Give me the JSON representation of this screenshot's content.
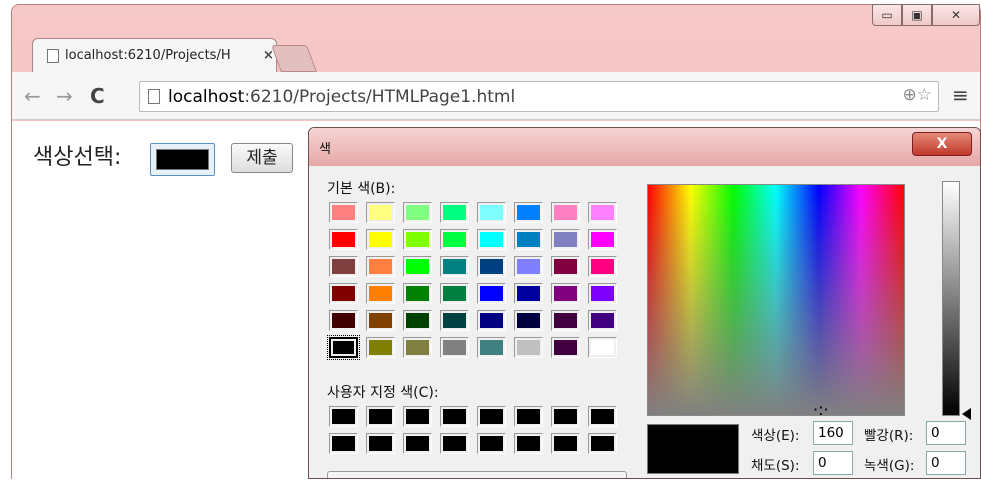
{
  "browser": {
    "tab_title": "localhost:6210/Projects/H",
    "tab_close": "×",
    "url_host": "localhost",
    "url_rest": ":6210/Projects/HTMLPage1.html",
    "back_icon": "arrow-left-icon",
    "forward_icon": "arrow-right-icon",
    "reload_icon": "reload-icon",
    "minimize": "▭",
    "maximize": "▣",
    "close": "✕"
  },
  "page": {
    "label": "색상선택:",
    "submit_label": "제출",
    "color_value": "#000000"
  },
  "dialog": {
    "title": "색",
    "close_label": "X",
    "basic_colors_label": "기본 색(B):",
    "custom_colors_label": "사용자 지정 색(C):",
    "basic_colors": [
      "#ff8080",
      "#ffff80",
      "#80ff80",
      "#00ff80",
      "#80ffff",
      "#0080ff",
      "#ff80c0",
      "#ff80ff",
      "#ff0000",
      "#ffff00",
      "#80ff00",
      "#00ff40",
      "#00ffff",
      "#0080c0",
      "#8080c0",
      "#ff00ff",
      "#804040",
      "#ff8040",
      "#00ff00",
      "#008080",
      "#004080",
      "#8080ff",
      "#800040",
      "#ff0080",
      "#800000",
      "#ff8000",
      "#008000",
      "#008040",
      "#0000ff",
      "#0000a0",
      "#800080",
      "#8000ff",
      "#400000",
      "#804000",
      "#004000",
      "#004040",
      "#000080",
      "#000040",
      "#400040",
      "#400080",
      "#000000",
      "#808000",
      "#808040",
      "#808080",
      "#408080",
      "#c0c0c0",
      "#400040",
      "#ffffff"
    ],
    "custom_colors": [
      "#000000",
      "#000000",
      "#000000",
      "#000000",
      "#000000",
      "#000000",
      "#000000",
      "#000000",
      "#000000",
      "#000000",
      "#000000",
      "#000000",
      "#000000",
      "#000000",
      "#000000",
      "#000000"
    ],
    "hue_label": "색상(E):",
    "hue_value": "160",
    "red_label": "빨강(R):",
    "red_value": "0",
    "sat_label": "채도(S):",
    "sat_value": "0",
    "green_label": "녹색(G):",
    "green_value": "0",
    "preview_color": "#000000"
  }
}
